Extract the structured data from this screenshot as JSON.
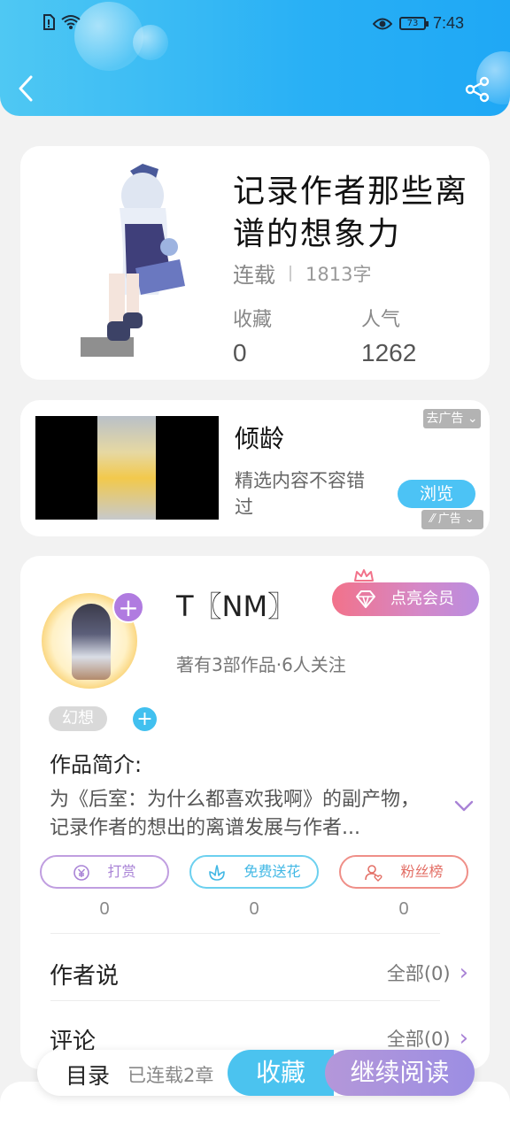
{
  "status_bar": {
    "time": "7:43",
    "battery": "73"
  },
  "book": {
    "title": "记录作者那些离谱的想象力",
    "status": "连载",
    "word_count": "1813字",
    "favorites_label": "收藏",
    "favorites_value": "0",
    "popularity_label": "人气",
    "popularity_value": "1262"
  },
  "ad": {
    "title": "倾龄",
    "description": "精选内容不容错过",
    "browse_label": "浏览",
    "remove_ad_label": "去广告",
    "ad_tag_label": "广告"
  },
  "author": {
    "name": "T〖NM〗",
    "vip_label": "点亮会员",
    "meta": "著有3部作品·6人关注",
    "tag": "幻想",
    "intro_label": "作品简介:",
    "intro_text": "为《后室：为什么都喜欢我啊》的副产物，记录作者的想出的离谱发展与作者..."
  },
  "actions": [
    {
      "label": "打赏",
      "count": "0"
    },
    {
      "label": "免费送花",
      "count": "0"
    },
    {
      "label": "粉丝榜",
      "count": "0"
    }
  ],
  "sections": {
    "author_says_label": "作者说",
    "author_says_right": "全部(0)",
    "comments_label": "评论",
    "comments_right": "全部(0)"
  },
  "bottom_bar": {
    "toc_label": "目录",
    "toc_status": "已连载2章",
    "favorite_label": "收藏",
    "continue_label": "继续阅读"
  },
  "colors": {
    "header": "#29b0f5",
    "accent_blue": "#4bc3ef",
    "accent_purple": "#a983d6",
    "accent_red": "#e36f66"
  }
}
